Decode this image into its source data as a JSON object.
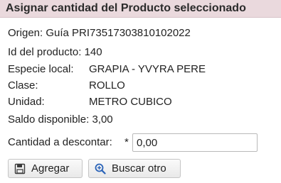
{
  "panel": {
    "title": "Asignar cantidad del Producto seleccionado"
  },
  "details": {
    "origen": "Origen: Guía PRI73517303810102022",
    "id_producto_label": "Id del producto:",
    "id_producto_value": "140",
    "especie_label": "Especie local:",
    "especie_value": "GRAPIA - YVYRA PERE",
    "clase_label": "Clase:",
    "clase_value": "ROLLO",
    "unidad_label": "Unidad:",
    "unidad_value": "METRO CUBICO",
    "saldo_label": "Saldo disponible:",
    "saldo_value": "3,00"
  },
  "form": {
    "cantidad_label": "Cantidad a descontar:",
    "required_marker": "*",
    "cantidad_value": "0,00"
  },
  "buttons": {
    "agregar_label": "Agregar",
    "agregar_icon": "save-icon",
    "buscar_label": "Buscar otro",
    "buscar_icon": "zoom-search-icon"
  },
  "colors": {
    "title_bg": "#ead9dd",
    "search_icon_accent": "#2a63b8"
  }
}
